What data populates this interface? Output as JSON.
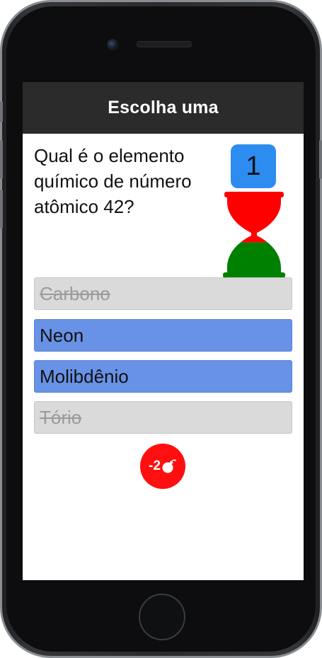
{
  "nav": {
    "title": "Escolha uma"
  },
  "quiz": {
    "question": "Qual é o elemento químico de número atômico 42?",
    "counter": "1",
    "timer_fraction_remaining": 0.6,
    "colors": {
      "timer_top": "#ff0000",
      "timer_bottom": "#008000",
      "counter_bg": "#2d8cf0",
      "option_active": "#6792e6",
      "option_disabled": "#dadada",
      "bomb_bg": "#ff0f0f"
    },
    "options": [
      {
        "label": "Carbono",
        "state": "eliminated"
      },
      {
        "label": "Neon",
        "state": "available"
      },
      {
        "label": "Molibdênio",
        "state": "available"
      },
      {
        "label": "Tório",
        "state": "eliminated"
      }
    ],
    "bomb": {
      "label": "-2",
      "icon": "bomb-icon"
    }
  }
}
